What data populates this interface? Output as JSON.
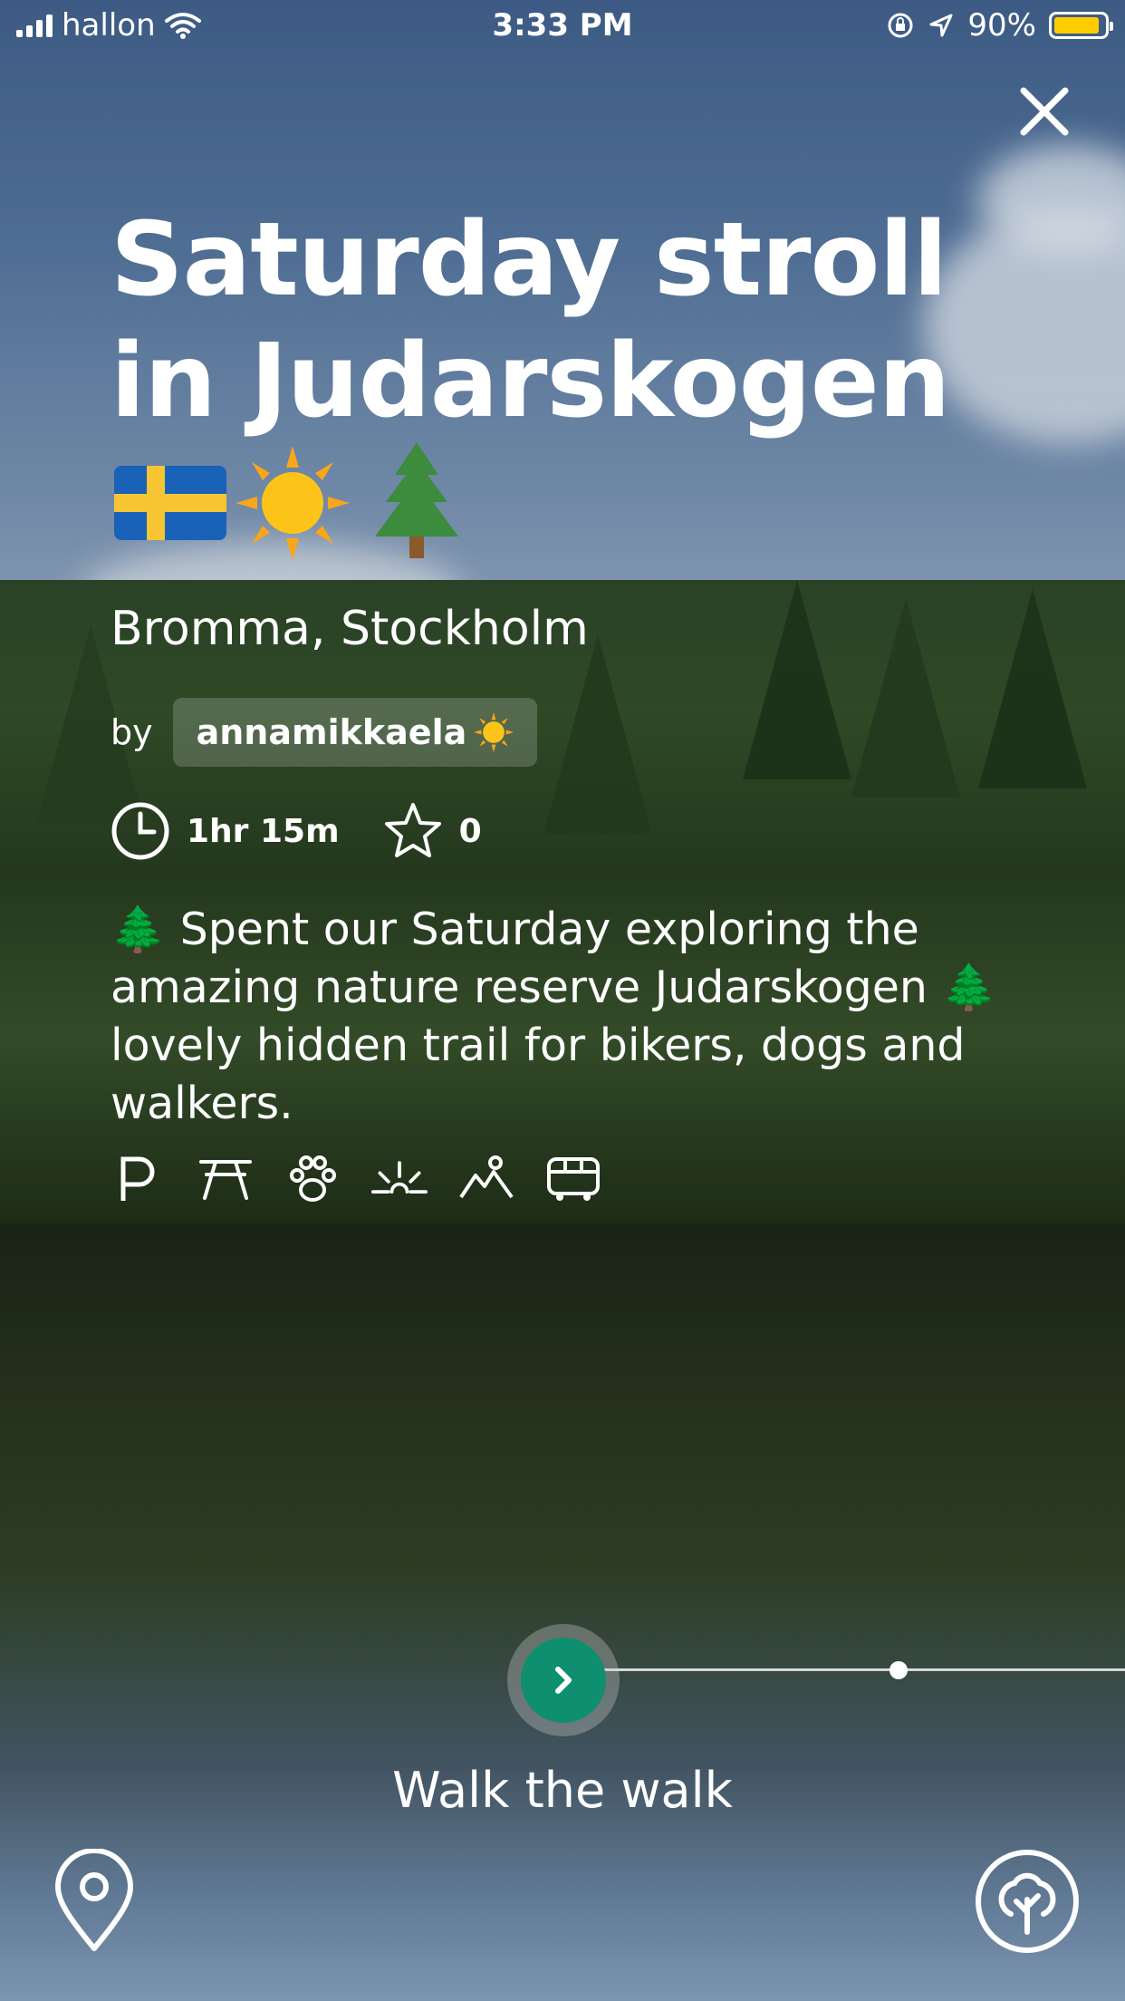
{
  "status_bar": {
    "carrier": "hallon",
    "time": "3:33 PM",
    "battery_percent": "90%",
    "battery_level": 0.9,
    "battery_color": "#ffcc00"
  },
  "walk": {
    "title": "Saturday stroll in Judarskogen",
    "title_emojis": "🇸🇪☀️🌲",
    "location": "Bromma, Stockholm",
    "by_label": "by",
    "author": "annamikkaela",
    "author_emoji": "☀️",
    "duration": "1hr 15m",
    "stars": "0",
    "description": "🌲 Spent our Saturday exploring the amazing nature reserve Judarskogen 🌲 lovely hidden trail for bikers, dogs and walkers.",
    "amenities": [
      "parking-icon",
      "picnic-table-icon",
      "dog-paw-icon",
      "sunset-icon",
      "hiking-icon",
      "bus-icon"
    ]
  },
  "actions": {
    "walk_label": "Walk the walk",
    "accent_color": "#0e8f6f"
  },
  "icons": {
    "close": "close-icon",
    "map_pin": "map-pin-icon",
    "tree": "tree-icon"
  }
}
